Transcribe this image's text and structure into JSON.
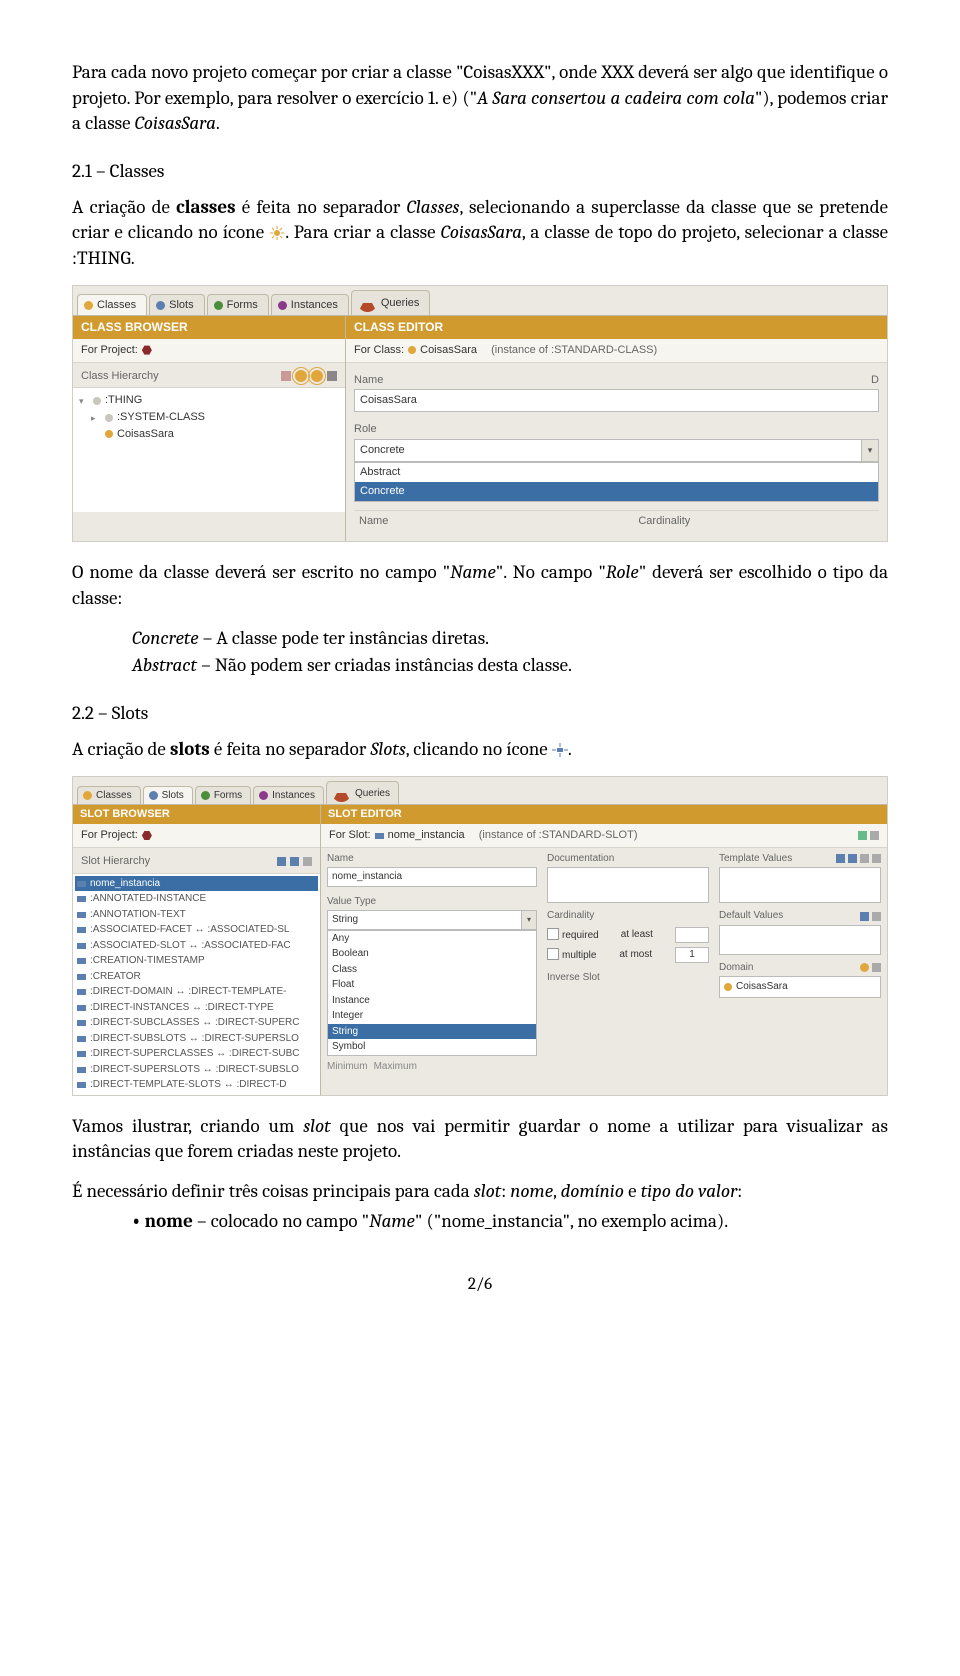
{
  "para1_a": "Para cada novo projeto começar por criar a classe \"CoisasXXX\", onde XXX deverá ser algo que identifique o projeto. Por exemplo, para resolver o exercício 1. e) (\"",
  "para1_b": "A Sara consertou a cadeira com cola",
  "para1_c": "\"), podemos criar a classe ",
  "para1_d": "CoisasSara",
  "para1_e": ".",
  "sec21": "2.1 – Classes",
  "para2_a": "A criação de ",
  "para2_b": "classes",
  "para2_c": " é feita no separador ",
  "para2_d": "Classes",
  "para2_e": ", selecionando a superclasse da classe que se pretende criar e clicando no ícone ",
  "para2_f": ". Para criar a classe ",
  "para2_g": "CoisasSara",
  "para2_h": ", a classe de topo do projeto, selecionar a classe :THING.",
  "shot1": {
    "tabs": [
      "Classes",
      "Slots",
      "Forms",
      "Instances",
      "Queries"
    ],
    "browser_title": "CLASS BROWSER",
    "editor_title": "CLASS EDITOR",
    "for_project": "For Project:",
    "for_class": "For Class:",
    "class_name": "CoisasSara",
    "instance_of": "(instance of :STANDARD-CLASS)",
    "hierarchy": "Class Hierarchy",
    "tree": [
      ":THING",
      ":SYSTEM-CLASS",
      "CoisasSara"
    ],
    "name_lbl": "Name",
    "d_lbl": "D",
    "name_val": "CoisasSara",
    "role_lbl": "Role",
    "role_val": "Concrete",
    "role_opts": [
      "Abstract",
      "Concrete"
    ],
    "tbl_name": "Name",
    "tbl_card": "Cardinality"
  },
  "para3_a": "O nome da classe deverá ser escrito no campo \"",
  "para3_b": "Name",
  "para3_c": "\". No campo \"",
  "para3_d": "Role",
  "para3_e": "\" deverá ser escolhido o tipo da classe:",
  "li1_a": "Concrete",
  "li1_b": " – A classe pode ter instâncias diretas.",
  "li2_a": "Abstract",
  "li2_b": " – Não podem ser criadas instâncias desta classe.",
  "sec22": "2.2 – Slots",
  "para4_a": "A criação de ",
  "para4_b": "slots",
  "para4_c": " é feita no separador ",
  "para4_d": "Slots",
  "para4_e": ", clicando no ícone ",
  "para4_f": ".",
  "shot2": {
    "tabs": [
      "Classes",
      "Slots",
      "Forms",
      "Instances",
      "Queries"
    ],
    "browser_title": "SLOT BROWSER",
    "editor_title": "SLOT EDITOR",
    "for_project": "For Project:",
    "for_slot": "For Slot:",
    "slot_name": "nome_instancia",
    "instance_of": "(instance of :STANDARD-SLOT)",
    "hierarchy": "Slot Hierarchy",
    "tree": [
      "nome_instancia",
      ":ANNOTATED-INSTANCE",
      ":ANNOTATION-TEXT",
      ":ASSOCIATED-FACET ↔ :ASSOCIATED-SL",
      ":ASSOCIATED-SLOT ↔ :ASSOCIATED-FAC",
      ":CREATION-TIMESTAMP",
      ":CREATOR",
      ":DIRECT-DOMAIN ↔ :DIRECT-TEMPLATE-",
      ":DIRECT-INSTANCES ↔ :DIRECT-TYPE",
      ":DIRECT-SUBCLASSES ↔ :DIRECT-SUPERC",
      ":DIRECT-SUBSLOTS ↔ :DIRECT-SUPERSLO",
      ":DIRECT-SUPERCLASSES ↔ :DIRECT-SUBC",
      ":DIRECT-SUPERSLOTS ↔ :DIRECT-SUBSLO",
      ":DIRECT-TEMPLATE-SLOTS ↔ :DIRECT-D"
    ],
    "name_lbl": "Name",
    "name_val": "nome_instancia",
    "doc_lbl": "Documentation",
    "tmpl_lbl": "Template Values",
    "vt_lbl": "Value Type",
    "vt_val": "String",
    "vt_opts": [
      "Any",
      "Boolean",
      "Class",
      "Float",
      "Instance",
      "Integer",
      "String",
      "Symbol"
    ],
    "min_lbl": "Minimum",
    "max_lbl": "Maximum",
    "card_lbl": "Cardinality",
    "req_lbl": "required",
    "atleast_lbl": "at least",
    "mult_lbl": "multiple",
    "atmost_lbl": "at most",
    "atmost_val": "1",
    "inv_lbl": "Inverse Slot",
    "def_lbl": "Default Values",
    "dom_lbl": "Domain",
    "dom_val": "CoisasSara"
  },
  "para5_a": "Vamos ilustrar, criando um ",
  "para5_b": "slot",
  "para5_c": " que nos vai permitir guardar o nome a utilizar para visualizar as instâncias que forem criadas neste projeto.",
  "para6_a": "É necessário definir três coisas principais para cada ",
  "para6_b": "slot",
  "para6_c": ": ",
  "para6_d": "nome",
  "para6_e": ", ",
  "para6_f": "domínio",
  "para6_g": " e ",
  "para6_h": "tipo do valor",
  "para6_i": ":",
  "bul1_a": "nome",
  "bul1_b": " – colocado no campo \"",
  "bul1_c": "Name",
  "bul1_d": "\" (\"nome_instancia\", no exemplo acima).",
  "page": "2/6"
}
